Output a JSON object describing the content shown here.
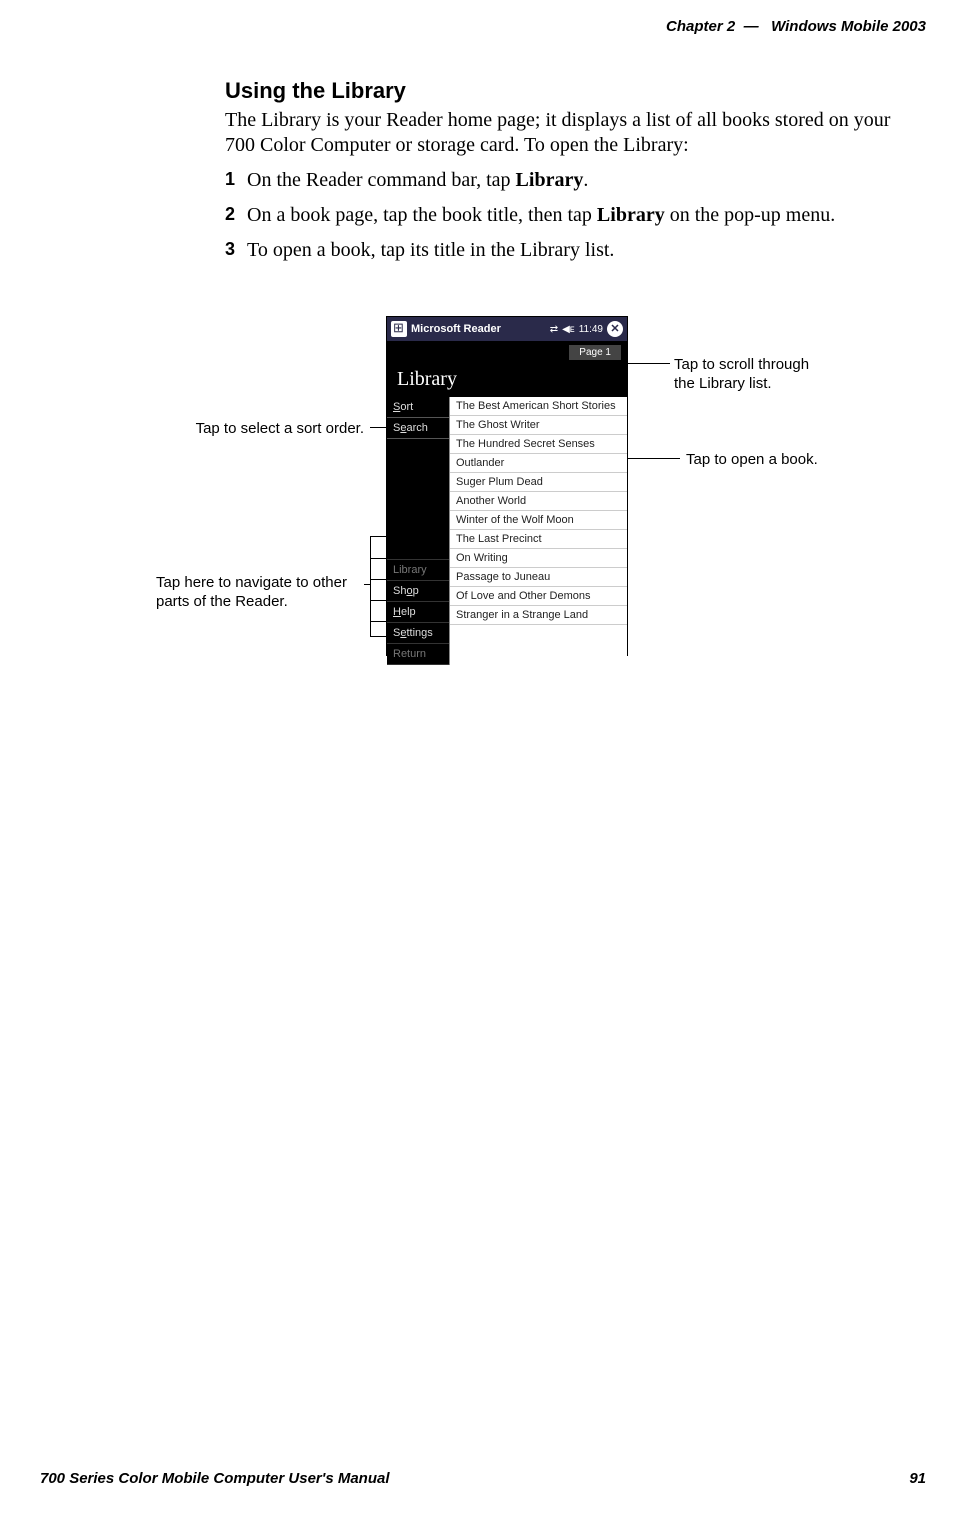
{
  "header": {
    "chapter": "Chapter  2",
    "dash": "—",
    "title": "Windows Mobile 2003"
  },
  "section": {
    "title": "Using the Library",
    "intro": "The Library is your Reader home page; it displays a list of all books stored on your 700 Color Computer or storage card. To open the Library:",
    "steps": [
      {
        "num": "1",
        "pre": "On the Reader command bar, tap ",
        "bold": "Library",
        "post": "."
      },
      {
        "num": "2",
        "pre": "On a book page, tap the book title, then tap ",
        "bold": "Library",
        "post": " on the pop-up menu."
      },
      {
        "num": "3",
        "pre": "To open a book, tap its title in the Library list.",
        "bold": "",
        "post": ""
      }
    ]
  },
  "callouts": {
    "sort": "Tap to select a sort order.",
    "nav": "Tap here to navigate to other parts of the Reader.",
    "scroll": "Tap to scroll through the Library list.",
    "open": "Tap to open a book."
  },
  "device": {
    "titlebar": {
      "app": "Microsoft Reader",
      "time": "11:49"
    },
    "library_label": "Library",
    "page_label": "Page 1",
    "side_top": [
      {
        "u": "S",
        "rest": "ort"
      },
      {
        "u": "S",
        "rest": "",
        "mid": "e",
        "rest2": "arch",
        "underline_mid": true
      }
    ],
    "side_bottom": [
      {
        "label": "Library",
        "dim": true
      },
      {
        "label": "Shop",
        "u": "o",
        "pre": "Sh",
        "post": "p"
      },
      {
        "label": "Help",
        "u": "H",
        "post": "elp"
      },
      {
        "label": "Settings",
        "u": "e",
        "pre": "S",
        "post": "ttings"
      },
      {
        "label": "Return",
        "dim": true
      }
    ],
    "books": [
      "The Best American Short Stories",
      "The Ghost Writer",
      "The Hundred Secret Senses",
      "Outlander",
      "Suger Plum Dead",
      "Another World",
      "Winter of the Wolf Moon",
      "The Last Precinct",
      "On Writing",
      "Passage to Juneau",
      "Of Love and Other Demons",
      "Stranger in a Strange Land"
    ]
  },
  "footer": {
    "left": "700 Series Color Mobile Computer User's Manual",
    "right": "91"
  }
}
